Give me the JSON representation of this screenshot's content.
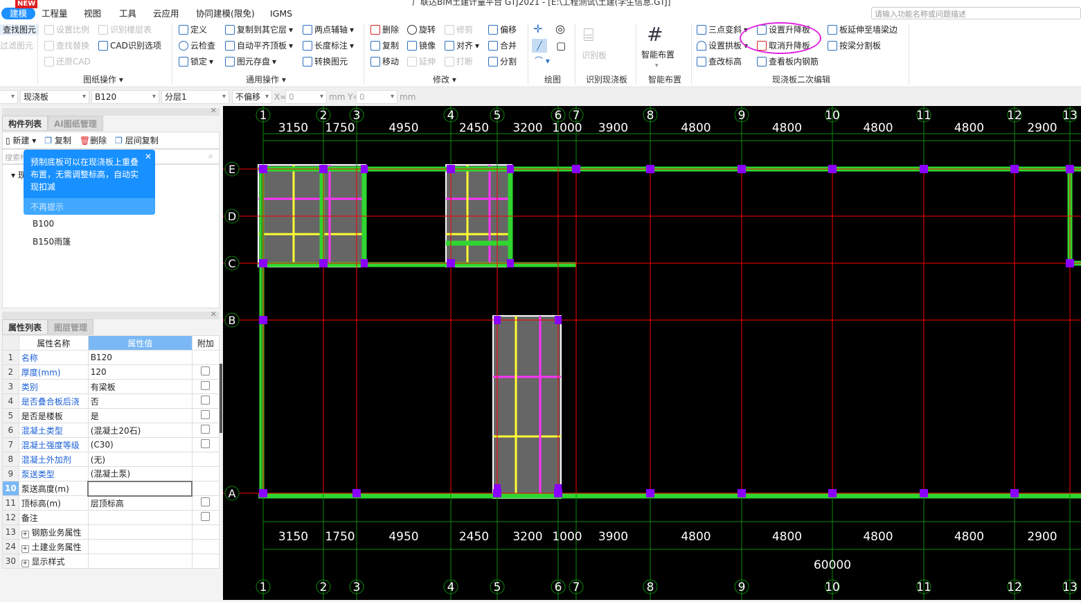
{
  "titlebar": {
    "badge": "NEW",
    "title": "广联达BIM土建计量平台 GTJ2021 - [E:\\工程测试\\土建(学生信息.GTJ]"
  },
  "menu": [
    "建模",
    "工程量",
    "视图",
    "工具",
    "云应用",
    "协同建模(限免)",
    "IGMS"
  ],
  "search_placeholder": "请输入功能名称或问题描述",
  "ribbon": {
    "left_partial": [
      "查找图元",
      "过滤图元"
    ],
    "drawing_ops": {
      "items": [
        "设置比例",
        "识别楼层表",
        "查找替换",
        "CAD识别选项",
        "还原CAD"
      ],
      "label": "图纸操作"
    },
    "general_ops": {
      "items": [
        "定义",
        "复制到其它层",
        "两点辅轴",
        "云检查",
        "自动平齐顶板",
        "长度标注",
        "锁定",
        "图元存盘",
        "转换图元"
      ],
      "label": "通用操作"
    },
    "modify": {
      "items": [
        "删除",
        "旋转",
        "修剪",
        "偏移",
        "复制",
        "镜像",
        "对齐",
        "合并",
        "移动",
        "延伸",
        "打断",
        "分割"
      ],
      "label": "修改"
    },
    "draw": {
      "label": "绘图"
    },
    "identify": {
      "item": "识别板",
      "label": "识别现浇板"
    },
    "smart": {
      "item": "智能布置",
      "label": "智能布置"
    },
    "secondary": {
      "items": [
        "三点变斜",
        "设置升降板",
        "板延伸至墙梁边",
        "设置拱板",
        "取消升降板",
        "按梁分割板",
        "查改标高",
        "查看板内钢筋"
      ],
      "label": "现浇板二次编辑"
    }
  },
  "toolbar": {
    "type": "现浇板",
    "name": "B120",
    "layer": "分层1",
    "offset": "不偏移",
    "x_label": "X=",
    "x": "0",
    "y_label": "mm Y=",
    "y": "0",
    "unit": "mm"
  },
  "component_panel": {
    "tabs": [
      "构件列表",
      "AI图纸管理"
    ],
    "actions": [
      "新建",
      "复制",
      "删除",
      "层间复制"
    ],
    "search_placeholder": "搜索构件...",
    "tree_root": "现浇板",
    "items": [
      "B100",
      "B150雨篷"
    ]
  },
  "tooltip": {
    "text": "预制底板可以在现浇板上重叠布置，无需调整标高，自动实现扣减",
    "dismiss": "不再提示"
  },
  "property_panel": {
    "tabs": [
      "属性列表",
      "图层管理"
    ],
    "headers": [
      "属性名称",
      "属性值",
      "附加"
    ],
    "rows": [
      {
        "no": "1",
        "name": "名称",
        "value": "B120",
        "blue": true,
        "check": false
      },
      {
        "no": "2",
        "name": "厚度(mm)",
        "value": "120",
        "blue": true,
        "check": true
      },
      {
        "no": "3",
        "name": "类别",
        "value": "有梁板",
        "blue": true,
        "check": true
      },
      {
        "no": "4",
        "name": "是否叠合板后浇",
        "value": "否",
        "blue": true,
        "check": true
      },
      {
        "no": "5",
        "name": "是否是楼板",
        "value": "是",
        "blue": false,
        "check": true
      },
      {
        "no": "6",
        "name": "混凝土类型",
        "value": "(混凝土20石)",
        "blue": true,
        "check": true
      },
      {
        "no": "7",
        "name": "混凝土强度等级",
        "value": "(C30)",
        "blue": true,
        "check": true
      },
      {
        "no": "8",
        "name": "混凝土外加剂",
        "value": "(无)",
        "blue": true,
        "check": false
      },
      {
        "no": "9",
        "name": "泵送类型",
        "value": "(混凝土泵)",
        "blue": true,
        "check": false
      },
      {
        "no": "10",
        "name": "泵送高度(m)",
        "value": "",
        "blue": false,
        "check": false,
        "editing": true
      },
      {
        "no": "11",
        "name": "顶标高(m)",
        "value": "层顶标高",
        "blue": false,
        "check": true
      },
      {
        "no": "12",
        "name": "备注",
        "value": "",
        "blue": false,
        "check": true
      },
      {
        "no": "13",
        "name": "钢筋业务属性",
        "value": "",
        "expand": true
      },
      {
        "no": "24",
        "name": "土建业务属性",
        "value": "",
        "expand": true
      },
      {
        "no": "30",
        "name": "显示样式",
        "value": "",
        "expand": true
      }
    ]
  },
  "cad": {
    "x_axes": [
      "1",
      "2",
      "3",
      "4",
      "5",
      "6",
      "7",
      "8",
      "9",
      "10",
      "11",
      "12",
      "13"
    ],
    "y_axes": [
      "E",
      "D",
      "C",
      "B",
      "A"
    ],
    "spacings": [
      "3150",
      "1750",
      "4950",
      "2450",
      "3200",
      "1000",
      "3900",
      "4800",
      "4800",
      "4800",
      "4800",
      "2900"
    ],
    "total": "60000",
    "colors": {
      "beam": "#2fd62f",
      "column": "#8a00ff",
      "slab": "#666666",
      "axis": "#0a8a0a",
      "gridline": "#ff0000",
      "rebar_x": "#ffff33",
      "rebar_y": "#ff33ff"
    }
  }
}
